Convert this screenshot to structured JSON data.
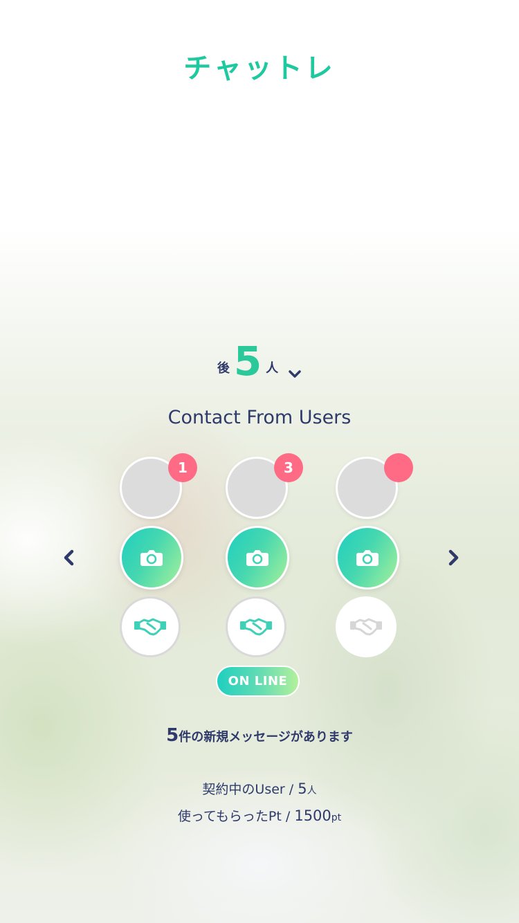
{
  "app": {
    "title": "チャットレ"
  },
  "remaining": {
    "prefix": "後",
    "count": "5",
    "suffix": "人"
  },
  "contacts_section": {
    "title": "Contact From Users"
  },
  "users": [
    {
      "badge": "1"
    },
    {
      "badge": "3"
    },
    {
      "badge": ""
    }
  ],
  "status": {
    "online_label": "ON LINE"
  },
  "messages": {
    "count": "5",
    "text": "件の新規メッセージがあります"
  },
  "stats": {
    "contract_label": "契約中のUser / ",
    "contract_value": "5",
    "contract_unit": "人",
    "points_label": "使ってもらったPt / ",
    "points_value": "1500",
    "points_unit": "pt"
  },
  "icons": {
    "chevron": "chevron-down-icon",
    "prev": "arrow-left-icon",
    "next": "arrow-right-icon",
    "camera": "camera-icon",
    "deal": "handshake-icon"
  },
  "colors": {
    "accent": "#1ec9a0",
    "text": "#2f3a6b",
    "badge": "#ff6b85",
    "gradient_start": "#1fcfc0",
    "gradient_end": "#a6f09a"
  }
}
